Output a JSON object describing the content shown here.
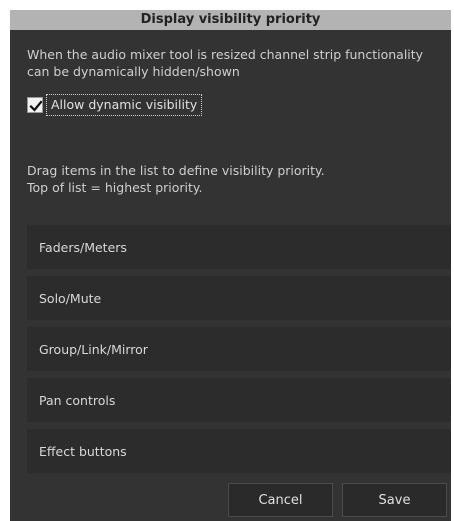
{
  "dialog": {
    "title": "Display visibility priority",
    "description": "When the audio mixer tool is resized channel strip functionality can be dynamically hidden/shown",
    "checkbox": {
      "label": "Allow dynamic visibility",
      "checked": true
    },
    "instructions_line1": "Drag items in the list to define visibility priority.",
    "instructions_line2": "Top of list = highest priority.",
    "items": [
      {
        "label": "Faders/Meters"
      },
      {
        "label": "Solo/Mute"
      },
      {
        "label": "Group/Link/Mirror"
      },
      {
        "label": "Pan controls"
      },
      {
        "label": "Effect buttons"
      }
    ],
    "buttons": {
      "cancel": "Cancel",
      "save": "Save"
    }
  },
  "colors": {
    "background": "#333333",
    "title_bar": "#b3b3b3",
    "list_item": "#2c2c2c"
  },
  "icons": {
    "checkmark": "check-icon"
  }
}
